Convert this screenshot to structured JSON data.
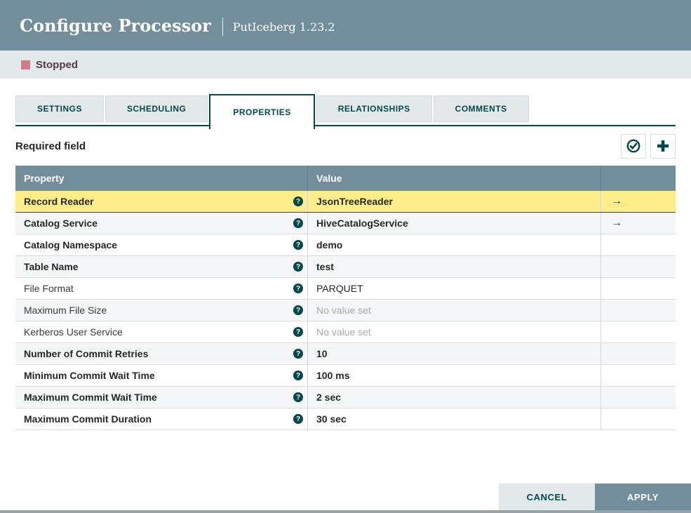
{
  "dialog": {
    "title": "Configure Processor",
    "subtitle": "PutIceberg 1.23.2"
  },
  "status": {
    "label": "Stopped"
  },
  "tabs": [
    {
      "label": "SETTINGS",
      "active": false
    },
    {
      "label": "SCHEDULING",
      "active": false
    },
    {
      "label": "PROPERTIES",
      "active": true
    },
    {
      "label": "RELATIONSHIPS",
      "active": false
    },
    {
      "label": "COMMENTS",
      "active": false
    }
  ],
  "toolbar": {
    "required_field_label": "Required field",
    "verify_button_icon": "check-circle-icon",
    "add_button_icon": "plus-icon"
  },
  "table": {
    "columns": [
      "Property",
      "Value"
    ],
    "rows": [
      {
        "property": "Record Reader",
        "value": "JsonTreeReader",
        "required": true,
        "selected": true,
        "has_goto": true,
        "no_value": false
      },
      {
        "property": "Catalog Service",
        "value": "HiveCatalogService",
        "required": true,
        "selected": false,
        "has_goto": true,
        "no_value": false
      },
      {
        "property": "Catalog Namespace",
        "value": "demo",
        "required": true,
        "selected": false,
        "has_goto": false,
        "no_value": false
      },
      {
        "property": "Table Name",
        "value": "test",
        "required": true,
        "selected": false,
        "has_goto": false,
        "no_value": false
      },
      {
        "property": "File Format",
        "value": "PARQUET",
        "required": false,
        "selected": false,
        "has_goto": false,
        "no_value": false
      },
      {
        "property": "Maximum File Size",
        "value": "No value set",
        "required": false,
        "selected": false,
        "has_goto": false,
        "no_value": true
      },
      {
        "property": "Kerberos User Service",
        "value": "No value set",
        "required": false,
        "selected": false,
        "has_goto": false,
        "no_value": true
      },
      {
        "property": "Number of Commit Retries",
        "value": "10",
        "required": true,
        "selected": false,
        "has_goto": false,
        "no_value": false
      },
      {
        "property": "Minimum Commit Wait Time",
        "value": "100 ms",
        "required": true,
        "selected": false,
        "has_goto": false,
        "no_value": false
      },
      {
        "property": "Maximum Commit Wait Time",
        "value": "2 sec",
        "required": true,
        "selected": false,
        "has_goto": false,
        "no_value": false
      },
      {
        "property": "Maximum Commit Duration",
        "value": "30 sec",
        "required": true,
        "selected": false,
        "has_goto": false,
        "no_value": false
      }
    ]
  },
  "footer": {
    "cancel_label": "CANCEL",
    "apply_label": "APPLY"
  },
  "colors": {
    "header_bg": "#728e9b",
    "accent_teal": "#004849",
    "selected_row_bg": "#fdee8a",
    "status_bar_bg": "#e3e8eb",
    "stopped_square": "#ca8087",
    "row_stripe": "#f4f6f7",
    "no_value_text": "#a9a9a9"
  }
}
